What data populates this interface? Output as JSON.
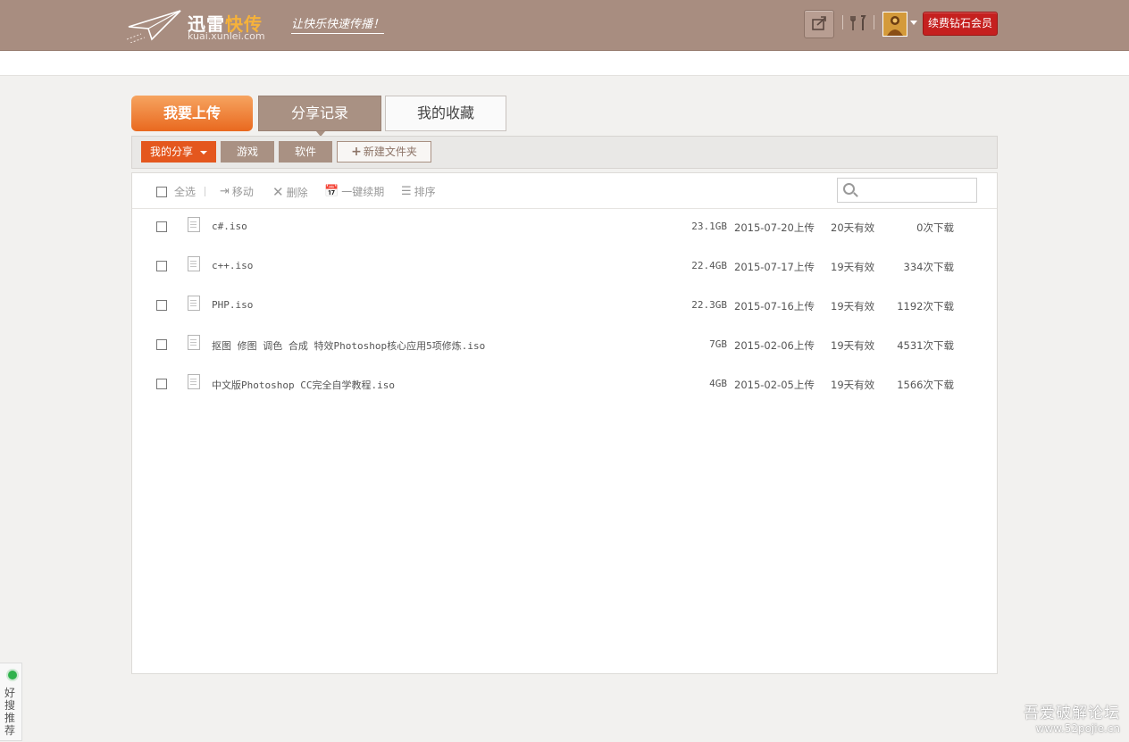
{
  "header": {
    "logo_name_part1": "迅雷",
    "logo_name_part2": "快传",
    "logo_url": "kuai.xunlei.com",
    "slogan": "让快乐快速传播！",
    "vip_button": "续费钻石会员"
  },
  "tabs": [
    {
      "label": "我要上传"
    },
    {
      "label": "分享记录"
    },
    {
      "label": "我的收藏"
    }
  ],
  "categories": {
    "my_share": "我的分享",
    "game": "游戏",
    "software": "软件",
    "new_folder": "新建文件夹"
  },
  "toolbar": {
    "select_all": "全选",
    "move": "移动",
    "delete": "删除",
    "renew": "一键续期",
    "sort": "排序",
    "search_placeholder": ""
  },
  "files": [
    {
      "name": "c#.iso",
      "size": "23.1GB",
      "date": "2015-07-20上传",
      "valid": "20天有效",
      "downloads": "0次下载"
    },
    {
      "name": "c++.iso",
      "size": "22.4GB",
      "date": "2015-07-17上传",
      "valid": "19天有效",
      "downloads": "334次下载"
    },
    {
      "name": "PHP.iso",
      "size": "22.3GB",
      "date": "2015-07-16上传",
      "valid": "19天有效",
      "downloads": "1192次下载"
    },
    {
      "name": "抠图 修图 调色 合成 特效Photoshop核心应用5项修炼.iso",
      "size": "7GB",
      "date": "2015-02-06上传",
      "valid": "19天有效",
      "downloads": "4531次下载"
    },
    {
      "name": "中文版Photoshop CC完全自学教程.iso",
      "size": "4GB",
      "date": "2015-02-05上传",
      "valid": "19天有效",
      "downloads": "1566次下载"
    }
  ],
  "side_widget": {
    "label": "好搜推荐"
  },
  "watermark": {
    "line1": "吾爱破解论坛",
    "line2": "www.52pojie.cn"
  },
  "colors": {
    "header_bg": "#a88d80",
    "accent_orange": "#e9691f",
    "my_share_red": "#e4571e",
    "vip_red": "#c5201f",
    "category_brown": "#a99183"
  }
}
